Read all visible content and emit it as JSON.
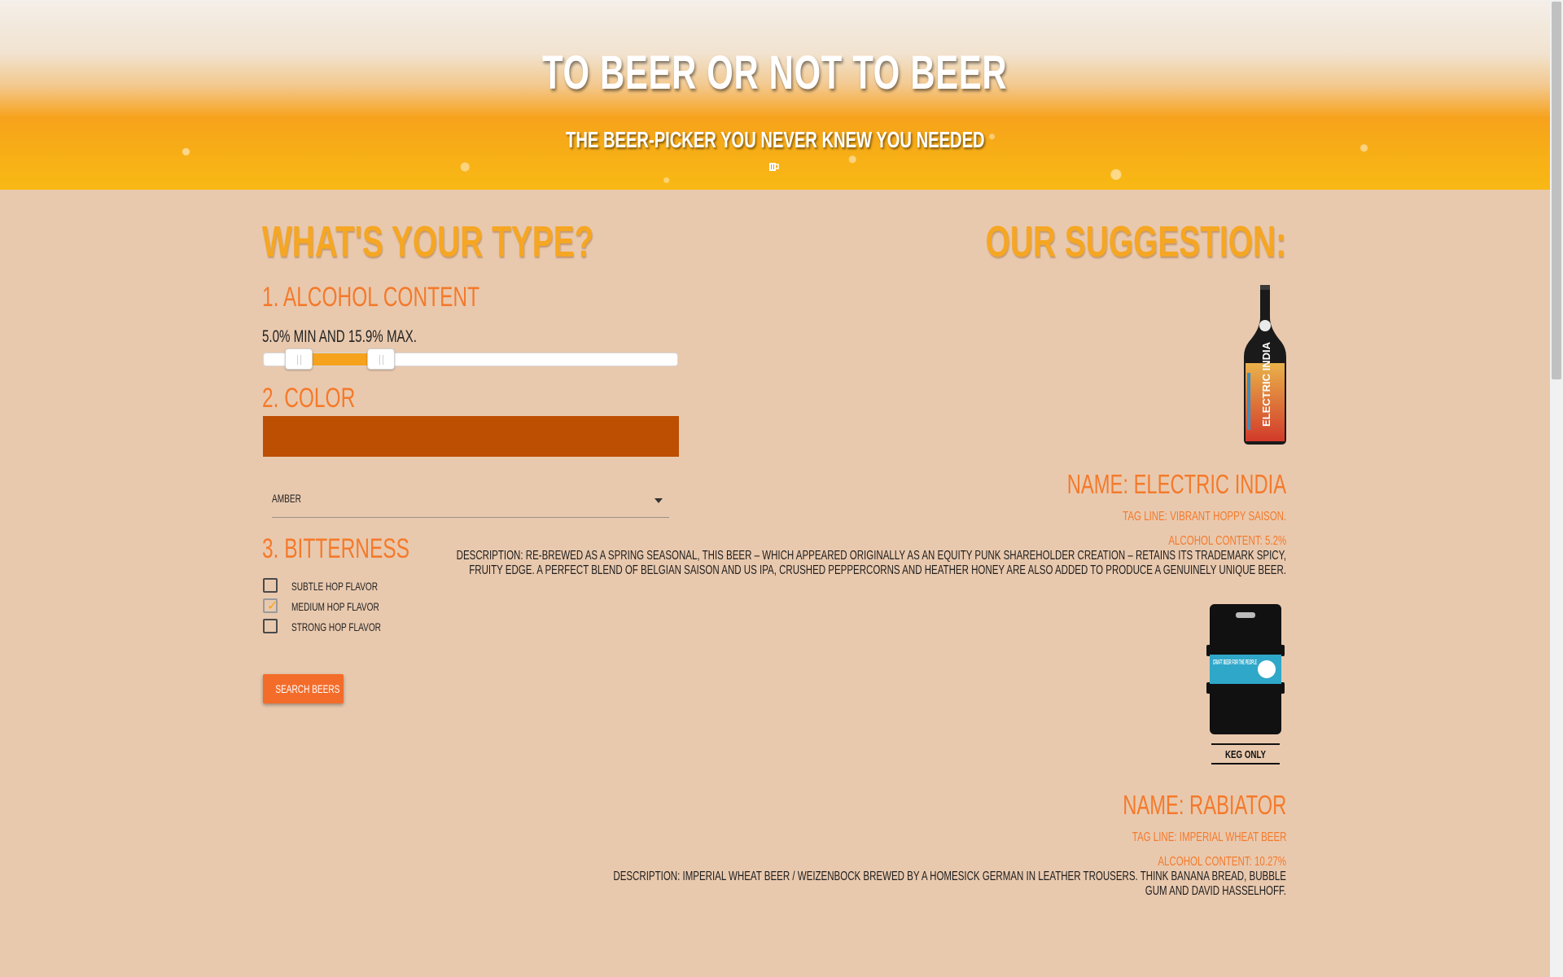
{
  "header": {
    "title": "TO BEER OR NOT TO BEER",
    "subtitle": "THE BEER-PICKER YOU NEVER KNEW YOU NEEDED",
    "icon": "beer-mug-icon"
  },
  "filters": {
    "heading": "WHAT'S YOUR TYPE?",
    "alcohol": {
      "heading": "1. ALCOHOL CONTENT",
      "summary": "5.0% MIN AND 15.9% MAX.",
      "min_value": 5.0,
      "max_value": 15.9
    },
    "color": {
      "heading": "2. COLOR",
      "swatch": "#bd4f03",
      "selected": "AMBER"
    },
    "bitterness": {
      "heading": "3. BITTERNESS",
      "options": [
        {
          "label": "SUBTLE HOP FLAVOR",
          "checked": false
        },
        {
          "label": "MEDIUM HOP FLAVOR",
          "checked": true
        },
        {
          "label": "STRONG HOP FLAVOR",
          "checked": false
        }
      ]
    },
    "search_label": "SEARCH BEERS"
  },
  "suggestions": {
    "heading": "OUR SUGGESTION:",
    "beers": [
      {
        "name": "NAME: ELECTRIC INDIA",
        "tagline": "TAG LINE: VIBRANT HOPPY SAISON.",
        "abv": "ALCOHOL CONTENT: 5.2%",
        "description": "DESCRIPTION: RE-BREWED AS A SPRING SEASONAL, THIS BEER – WHICH APPEARED ORIGINALLY AS AN EQUITY PUNK SHAREHOLDER CREATION – RETAINS ITS TRADEMARK SPICY, FRUITY EDGE. A PERFECT BLEND OF BELGIAN SAISON AND US IPA, CRUSHED PEPPERCORNS AND HEATHER HONEY ARE ALSO ADDED TO PRODUCE A GENUINELY UNIQUE BEER.",
        "image_label": "ELECTRIC INDIA"
      },
      {
        "name": "NAME: RABIATOR",
        "tagline": "TAG LINE: IMPERIAL WHEAT BEER",
        "abv": "ALCOHOL CONTENT: 10.27%",
        "description": "DESCRIPTION: IMPERIAL WHEAT BEER / WEIZENBOCK BREWED BY A HOMESICK GERMAN IN LEATHER TROUSERS. THINK BANANA BREAD, BUBBLE GUM AND DAVID HASSELHOFF.",
        "image_text": "CRAFT BEER FOR THE PEOPLE",
        "image_caption": "KEG ONLY"
      }
    ]
  },
  "colors": {
    "accent_orange": "#f47a2b",
    "heading_gold": "#f5a623",
    "background": "#e9c9ae",
    "button": "#f46c2a"
  }
}
